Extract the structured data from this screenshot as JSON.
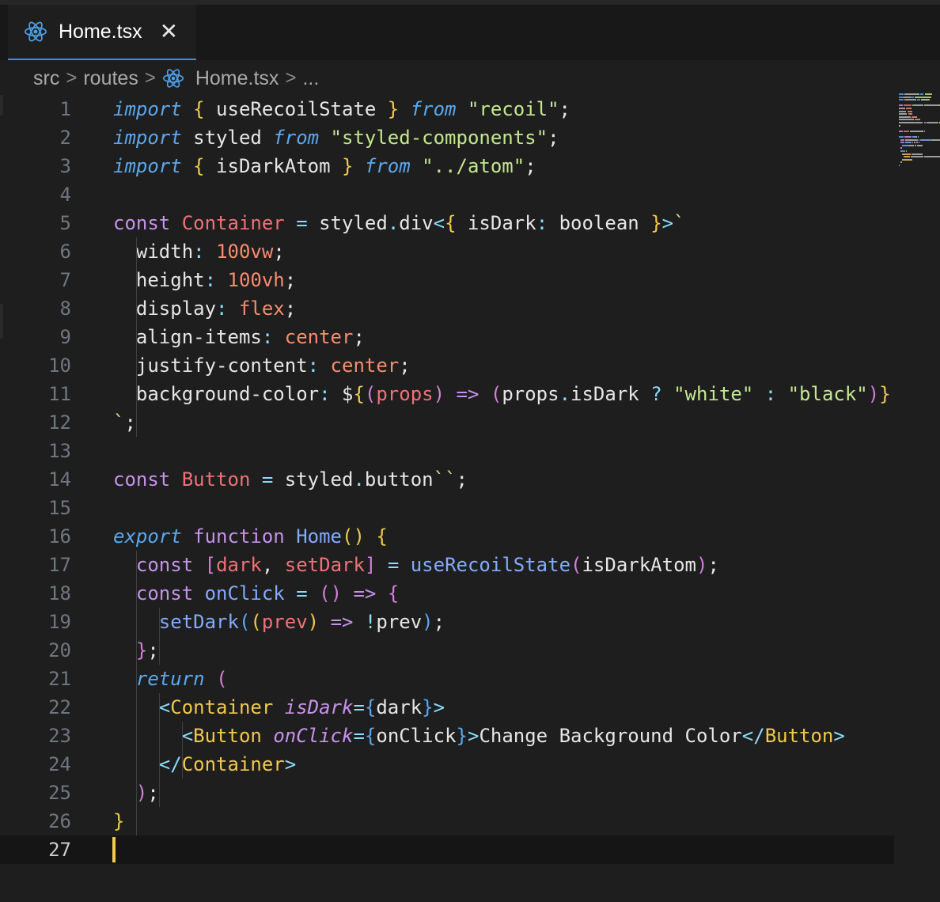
{
  "tab": {
    "label": "Home.tsx",
    "close": "✕"
  },
  "breadcrumb": {
    "items": [
      "src",
      "routes",
      "Home.tsx",
      "..."
    ],
    "separator": ">"
  },
  "editor": {
    "current_line": 27,
    "lines": [
      [
        [
          "kw-i",
          "import"
        ],
        [
          "tx",
          " "
        ],
        [
          "br1",
          "{"
        ],
        [
          "tx",
          " useRecoilState "
        ],
        [
          "br1",
          "}"
        ],
        [
          "tx",
          " "
        ],
        [
          "kw-i",
          "from"
        ],
        [
          "tx",
          " "
        ],
        [
          "str",
          "\"recoil\""
        ],
        [
          "tx",
          ";"
        ]
      ],
      [
        [
          "kw-i",
          "import"
        ],
        [
          "tx",
          " styled "
        ],
        [
          "kw-i",
          "from"
        ],
        [
          "tx",
          " "
        ],
        [
          "str",
          "\"styled-components\""
        ],
        [
          "tx",
          ";"
        ]
      ],
      [
        [
          "kw-i",
          "import"
        ],
        [
          "tx",
          " "
        ],
        [
          "br1",
          "{"
        ],
        [
          "tx",
          " isDarkAtom "
        ],
        [
          "br1",
          "}"
        ],
        [
          "tx",
          " "
        ],
        [
          "kw-i",
          "from"
        ],
        [
          "tx",
          " "
        ],
        [
          "str",
          "\"../atom\""
        ],
        [
          "tx",
          ";"
        ]
      ],
      [],
      [
        [
          "kw",
          "const"
        ],
        [
          "tx",
          " "
        ],
        [
          "cls",
          "Container"
        ],
        [
          "tx",
          " "
        ],
        [
          "op",
          "="
        ],
        [
          "tx",
          " styled"
        ],
        [
          "op",
          "."
        ],
        [
          "tx",
          "div"
        ],
        [
          "op",
          "<"
        ],
        [
          "br1",
          "{"
        ],
        [
          "tx",
          " isDark"
        ],
        [
          "op",
          ":"
        ],
        [
          "tx",
          " boolean "
        ],
        [
          "br1",
          "}"
        ],
        [
          "op",
          ">"
        ],
        [
          "str",
          "`"
        ]
      ],
      [
        [
          "tx",
          "  width"
        ],
        [
          "op",
          ":"
        ],
        [
          "tx",
          " "
        ],
        [
          "num",
          "100vw"
        ],
        [
          "tx",
          ";"
        ]
      ],
      [
        [
          "tx",
          "  height"
        ],
        [
          "op",
          ":"
        ],
        [
          "tx",
          " "
        ],
        [
          "num",
          "100vh"
        ],
        [
          "tx",
          ";"
        ]
      ],
      [
        [
          "tx",
          "  display"
        ],
        [
          "op",
          ":"
        ],
        [
          "tx",
          " "
        ],
        [
          "num",
          "flex"
        ],
        [
          "tx",
          ";"
        ]
      ],
      [
        [
          "tx",
          "  align-items"
        ],
        [
          "op",
          ":"
        ],
        [
          "tx",
          " "
        ],
        [
          "num",
          "center"
        ],
        [
          "tx",
          ";"
        ]
      ],
      [
        [
          "tx",
          "  justify-content"
        ],
        [
          "op",
          ":"
        ],
        [
          "tx",
          " "
        ],
        [
          "num",
          "center"
        ],
        [
          "tx",
          ";"
        ]
      ],
      [
        [
          "tx",
          "  background-color"
        ],
        [
          "op",
          ":"
        ],
        [
          "tx",
          " $"
        ],
        [
          "br1",
          "{"
        ],
        [
          "br2",
          "("
        ],
        [
          "var",
          "props"
        ],
        [
          "br2",
          ")"
        ],
        [
          "tx",
          " "
        ],
        [
          "kw",
          "=>"
        ],
        [
          "tx",
          " "
        ],
        [
          "br2",
          "("
        ],
        [
          "tx",
          "props"
        ],
        [
          "op",
          "."
        ],
        [
          "tx",
          "isDark "
        ],
        [
          "op",
          "?"
        ],
        [
          "tx",
          " "
        ],
        [
          "str",
          "\"white\""
        ],
        [
          "tx",
          " "
        ],
        [
          "op",
          ":"
        ],
        [
          "tx",
          " "
        ],
        [
          "str",
          "\"black\""
        ],
        [
          "br2",
          ")"
        ],
        [
          "br1",
          "}"
        ]
      ],
      [
        [
          "str",
          "`"
        ],
        [
          "tx",
          ";"
        ]
      ],
      [],
      [
        [
          "kw",
          "const"
        ],
        [
          "tx",
          " "
        ],
        [
          "cls",
          "Button"
        ],
        [
          "tx",
          " "
        ],
        [
          "op",
          "="
        ],
        [
          "tx",
          " styled"
        ],
        [
          "op",
          "."
        ],
        [
          "tx",
          "button"
        ],
        [
          "str",
          "``"
        ],
        [
          "tx",
          ";"
        ]
      ],
      [],
      [
        [
          "kw-i",
          "export"
        ],
        [
          "tx",
          " "
        ],
        [
          "kw",
          "function"
        ],
        [
          "tx",
          " "
        ],
        [
          "fn",
          "Home"
        ],
        [
          "br1",
          "()"
        ],
        [
          "tx",
          " "
        ],
        [
          "br1",
          "{"
        ]
      ],
      [
        [
          "tx",
          "  "
        ],
        [
          "kw",
          "const"
        ],
        [
          "tx",
          " "
        ],
        [
          "br2",
          "["
        ],
        [
          "var",
          "dark"
        ],
        [
          "tx",
          ", "
        ],
        [
          "var",
          "setDark"
        ],
        [
          "br2",
          "]"
        ],
        [
          "tx",
          " "
        ],
        [
          "op",
          "="
        ],
        [
          "tx",
          " "
        ],
        [
          "fn",
          "useRecoilState"
        ],
        [
          "br2",
          "("
        ],
        [
          "tx",
          "isDarkAtom"
        ],
        [
          "br2",
          ")"
        ],
        [
          "tx",
          ";"
        ]
      ],
      [
        [
          "tx",
          "  "
        ],
        [
          "kw",
          "const"
        ],
        [
          "tx",
          " "
        ],
        [
          "fn",
          "onClick"
        ],
        [
          "tx",
          " "
        ],
        [
          "op",
          "="
        ],
        [
          "tx",
          " "
        ],
        [
          "br2",
          "()"
        ],
        [
          "tx",
          " "
        ],
        [
          "kw",
          "=>"
        ],
        [
          "tx",
          " "
        ],
        [
          "br2",
          "{"
        ]
      ],
      [
        [
          "tx",
          "    "
        ],
        [
          "fn",
          "setDark"
        ],
        [
          "br3",
          "("
        ],
        [
          "br1",
          "("
        ],
        [
          "var",
          "prev"
        ],
        [
          "br1",
          ")"
        ],
        [
          "tx",
          " "
        ],
        [
          "kw",
          "=>"
        ],
        [
          "tx",
          " "
        ],
        [
          "op",
          "!"
        ],
        [
          "tx",
          "prev"
        ],
        [
          "br3",
          ")"
        ],
        [
          "tx",
          ";"
        ]
      ],
      [
        [
          "tx",
          "  "
        ],
        [
          "br2",
          "}"
        ],
        [
          "tx",
          ";"
        ]
      ],
      [
        [
          "tx",
          "  "
        ],
        [
          "kw-i",
          "return"
        ],
        [
          "tx",
          " "
        ],
        [
          "br2",
          "("
        ]
      ],
      [
        [
          "tx",
          "    "
        ],
        [
          "op",
          "<"
        ],
        [
          "tag",
          "Container"
        ],
        [
          "tx",
          " "
        ],
        [
          "attr",
          "isDark"
        ],
        [
          "op",
          "="
        ],
        [
          "br3",
          "{"
        ],
        [
          "tx",
          "dark"
        ],
        [
          "br3",
          "}"
        ],
        [
          "op",
          ">"
        ]
      ],
      [
        [
          "tx",
          "      "
        ],
        [
          "op",
          "<"
        ],
        [
          "tag",
          "Button"
        ],
        [
          "tx",
          " "
        ],
        [
          "attr",
          "onClick"
        ],
        [
          "op",
          "="
        ],
        [
          "br3",
          "{"
        ],
        [
          "tx",
          "onClick"
        ],
        [
          "br3",
          "}"
        ],
        [
          "op",
          ">"
        ],
        [
          "tx",
          "Change Background Color"
        ],
        [
          "op",
          "</"
        ],
        [
          "tag",
          "Button"
        ],
        [
          "op",
          ">"
        ]
      ],
      [
        [
          "tx",
          "    "
        ],
        [
          "op",
          "</"
        ],
        [
          "tag",
          "Container"
        ],
        [
          "op",
          ">"
        ]
      ],
      [
        [
          "tx",
          "  "
        ],
        [
          "br2",
          ")"
        ],
        [
          "tx",
          ";"
        ]
      ],
      [
        [
          "br1",
          "}"
        ]
      ],
      []
    ]
  },
  "colors": {
    "accent": "#3b8eea",
    "cursor": "#f2c94c",
    "background": "#1e1e1e"
  }
}
